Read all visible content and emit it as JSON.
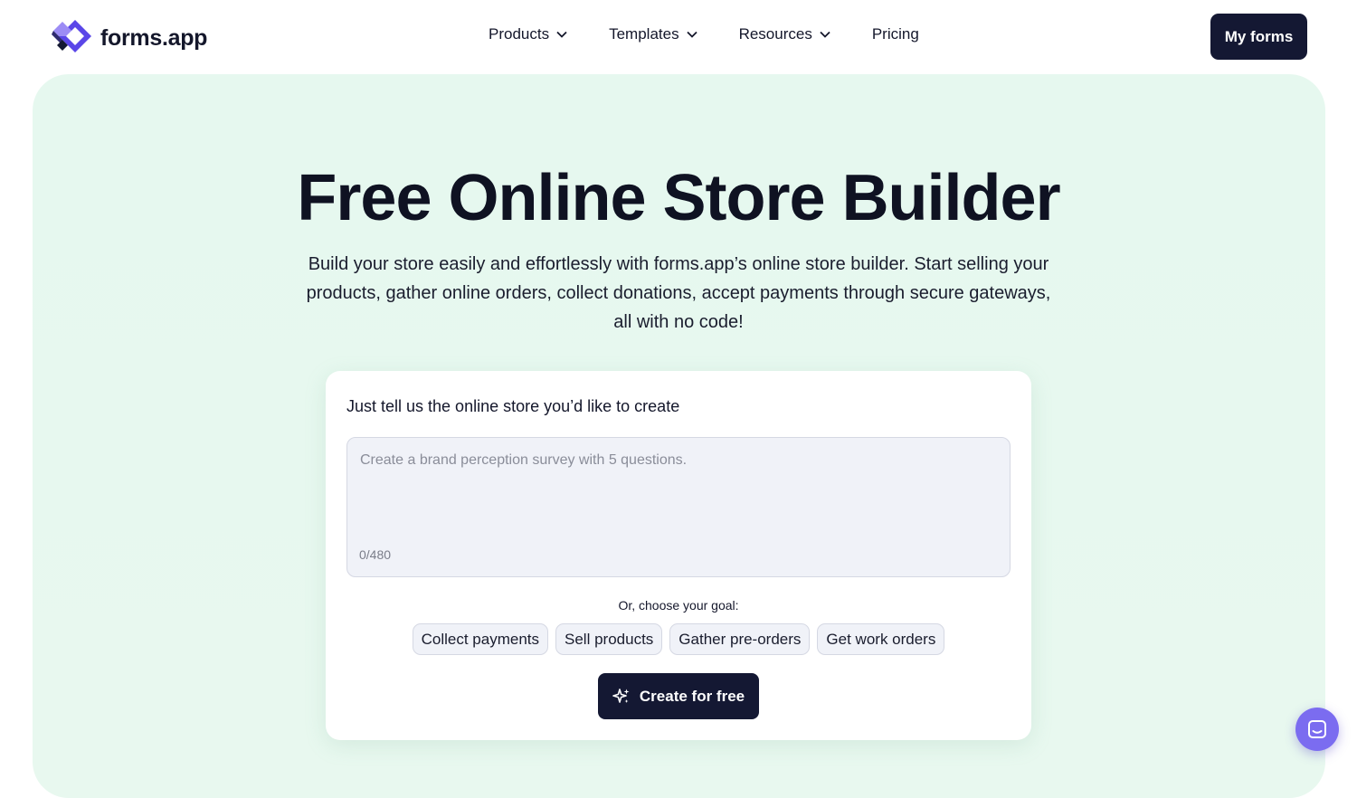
{
  "nav": {
    "logo_text": "forms.app",
    "menu": [
      {
        "label": "Products",
        "has_dropdown": true
      },
      {
        "label": "Templates",
        "has_dropdown": true
      },
      {
        "label": "Resources",
        "has_dropdown": true
      },
      {
        "label": "Pricing",
        "has_dropdown": false
      }
    ],
    "cta_label": "My forms"
  },
  "hero": {
    "title": "Free Online Store Builder",
    "subtitle": "Build your store easily and effortlessly with forms.app’s online store builder. Start selling your products, gather online orders, collect donations, accept payments through secure gateways, all with no code!"
  },
  "generator": {
    "label": "Just tell us the online store you’d like to create",
    "prompt_value": "",
    "prompt_placeholder": "Create a brand perception survey with 5 questions.",
    "char_counter": "0/480",
    "goal_label": "Or, choose your goal:",
    "goals": [
      "Collect payments",
      "Sell products",
      "Gather pre-orders",
      "Get work orders"
    ],
    "create_label": "Create for free"
  },
  "colors": {
    "brand_dark": "#141833",
    "hero_bg": "#e6f8ef",
    "logo_purple": "#6b5cf0",
    "chat_purple": "#7b6cf0"
  },
  "icons": [
    "forms-app-logo-icon",
    "chevron-down-icon",
    "sparkle-icon",
    "chat-icon"
  ]
}
